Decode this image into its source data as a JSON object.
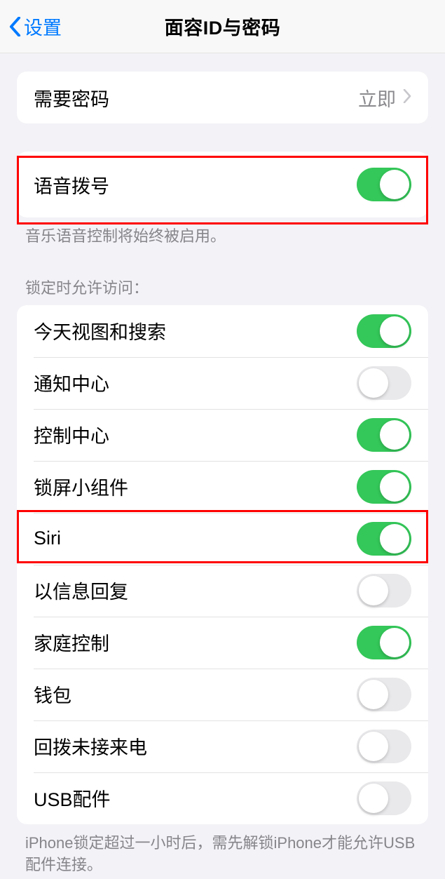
{
  "header": {
    "back_label": "设置",
    "title": "面容ID与密码"
  },
  "require_passcode": {
    "label": "需要密码",
    "value": "立即"
  },
  "voice_dial": {
    "label": "语音拨号",
    "on": true,
    "footer": "音乐语音控制将始终被启用。"
  },
  "lock_access": {
    "header": "锁定时允许访问：",
    "items": [
      {
        "label": "今天视图和搜索",
        "on": true
      },
      {
        "label": "通知中心",
        "on": false
      },
      {
        "label": "控制中心",
        "on": true
      },
      {
        "label": "锁屏小组件",
        "on": true
      },
      {
        "label": "Siri",
        "on": true
      },
      {
        "label": "以信息回复",
        "on": false
      },
      {
        "label": "家庭控制",
        "on": true
      },
      {
        "label": "钱包",
        "on": false
      },
      {
        "label": "回拨未接来电",
        "on": false
      },
      {
        "label": "USB配件",
        "on": false
      }
    ],
    "footer": "iPhone锁定超过一小时后，需先解锁iPhone才能允许USB配件连接。"
  }
}
